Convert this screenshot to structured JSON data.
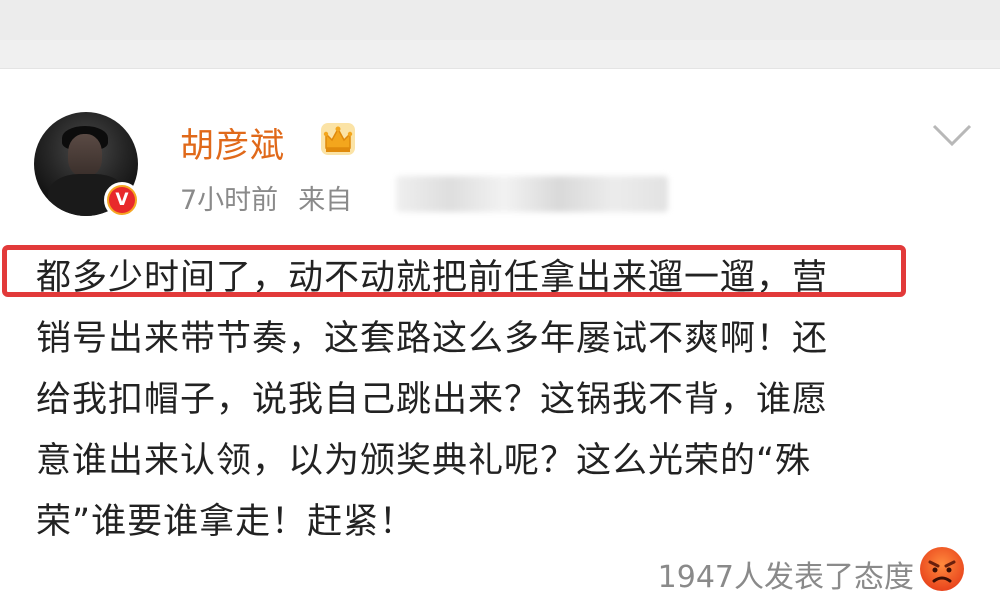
{
  "post": {
    "username": "胡彦斌",
    "verified_badge": "V",
    "time": "7小时前",
    "source_prefix": "来自",
    "lines": [
      "都多少时间了，动不动就把前任拿出来遛一遛，营",
      "销号出来带节奏，这套路这么多年屡试不爽啊！还",
      "给我扣帽子，说我自己跳出来？这锅我不背，谁愿",
      "意谁出来认领，以为颁奖典礼呢？这么光荣的“殊",
      "荣”谁要谁拿走！赶紧！"
    ],
    "reaction_text": "1947人发表了态度"
  },
  "icons": {
    "crown": "crown-icon",
    "chevron": "chevron-down-icon",
    "reaction": "angry-face-icon"
  },
  "colors": {
    "username": "#e0691a",
    "highlight": "#e23a3a",
    "meta": "#8a8a8a"
  }
}
